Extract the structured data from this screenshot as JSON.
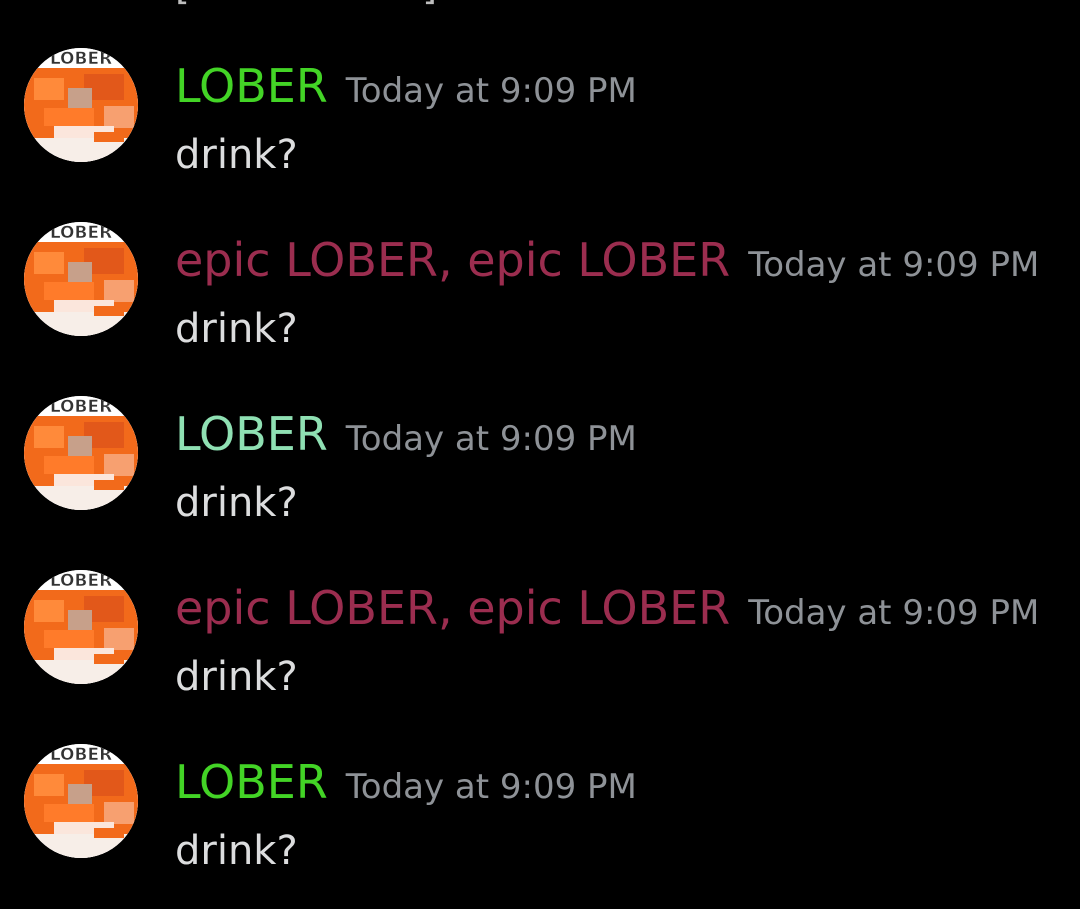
{
  "top_remnant": "[ — — — — ]",
  "colors": {
    "background": "#000000",
    "green": "#43d426",
    "teal": "#8fe0b3",
    "maroon": "#9b2d4f",
    "timestamp": "#8e9297",
    "text": "#dcddde"
  },
  "avatar": {
    "icon": "lobster-avatar-icon",
    "text": "LOBER"
  },
  "messages": [
    {
      "author": "LOBER",
      "author_color": "#43d426",
      "timestamp": "Today at 9:09 PM",
      "content": "drink?"
    },
    {
      "author": "epic LOBER, epic LOBER",
      "author_color": "#9b2d4f",
      "timestamp": "Today at 9:09 PM",
      "content": "drink?"
    },
    {
      "author": "LOBER",
      "author_color": "#8fe0b3",
      "timestamp": "Today at 9:09 PM",
      "content": "drink?"
    },
    {
      "author": "epic LOBER, epic LOBER",
      "author_color": "#9b2d4f",
      "timestamp": "Today at 9:09 PM",
      "content": "drink?"
    },
    {
      "author": "LOBER",
      "author_color": "#43d426",
      "timestamp": "Today at 9:09 PM",
      "content": "drink?"
    }
  ]
}
